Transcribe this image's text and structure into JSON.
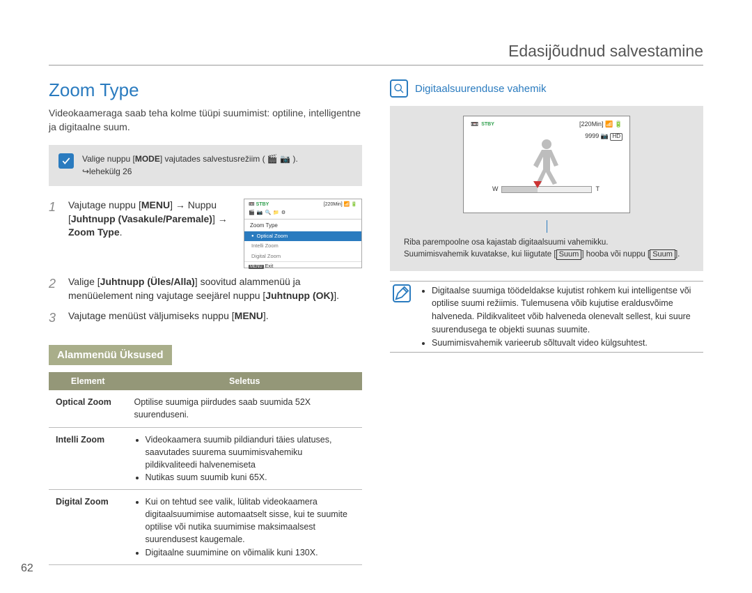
{
  "header": {
    "title": "Edasijõudnud salvestamine"
  },
  "left": {
    "section_title": "Zoom Type",
    "intro": "Videokaameraga saab teha kolme tüüpi suumimist: optiline, intelligentne ja digitaalne suum.",
    "mode_note_pre": "Valige nuppu [",
    "mode_note_key": "MODE",
    "mode_note_mid": "] vajutades salvestusrežiim ( 🎬 📷 ).",
    "mode_note_line2": "↪lehekülg 26",
    "steps": {
      "s1_a": "Vajutage nuppu [",
      "s1_menu": "MENU",
      "s1_b": "] → Nuppu [",
      "s1_joy": "Juhtnupp (Vasakule/Paremale)",
      "s1_c": "] → ",
      "s1_zoom": "Zoom Type",
      "s1_d": ".",
      "s2_a": "Valige [",
      "s2_joy": "Juhtnupp (Üles/Alla)",
      "s2_b": "] soovitud alammenüü ja menüüelement ning vajutage seejärel nuppu [",
      "s2_ok": "Juhtnupp (OK)",
      "s2_c": "].",
      "s3_a": "Vajutage menüüst väljumiseks nuppu [",
      "s3_menu": "MENU",
      "s3_b": "]."
    },
    "lcd": {
      "stby": "STBY",
      "time": "[220Min]",
      "zoom_title": "Zoom Type",
      "opt": "Optical Zoom",
      "intelli": "Intelli Zoom",
      "digital": "Digital Zoom",
      "menu_tag": "MENU",
      "exit": "Exit"
    },
    "submenu_badge": "Alammenüü Üksused",
    "table": {
      "h1": "Element",
      "h2": "Seletus",
      "r1_name": "Optical Zoom",
      "r1_desc": "Optilise suumiga piirdudes saab suumida 52X suurenduseni.",
      "r2_name": "Intelli Zoom",
      "r2_b1": "Videokaamera suumib pildianduri täies ulatuses, saavutades suurema suumimisvahemiku pildikvaliteedi halvenemiseta",
      "r2_b2": "Nutikas suum suumib kuni 65X.",
      "r3_name": "Digital Zoom",
      "r3_b1": "Kui on tehtud see valik, lülitab videokaamera digitaalsuumimise automaatselt sisse, kui te suumite optilise või nutika suumimise maksimaalsest suurendusest kaugemale.",
      "r3_b2": "Digitaalne suumimine on võimalik kuni 130X."
    }
  },
  "right": {
    "sub_title": "Digitaalsuurenduse vahemik",
    "lcd": {
      "stby": "STBY",
      "time": "[220Min]",
      "count": "9999",
      "hd": "HD"
    },
    "note1": "Riba parempoolne osa kajastab digitaalsuumi vahemikku.",
    "note2a": "Suumimisvahemik kuvatakse, kui liigutate [",
    "note2key1": "Suum",
    "note2b": "] hooba või nuppu [",
    "note2key2": "Suum",
    "note2c": "].",
    "bullets": {
      "b1": "Digitaalse suumiga töödeldakse kujutist rohkem kui intelligentse või optilise suumi režiimis. Tulemusena võib kujutise eraldusvõime halveneda. Pildikvaliteet võib halveneda olenevalt sellest, kui suure suurendusega te objekti suunas suumite.",
      "b2": "Suumimisvahemik varieerub sõltuvalt video külgsuhtest."
    }
  },
  "pagenum": "62"
}
